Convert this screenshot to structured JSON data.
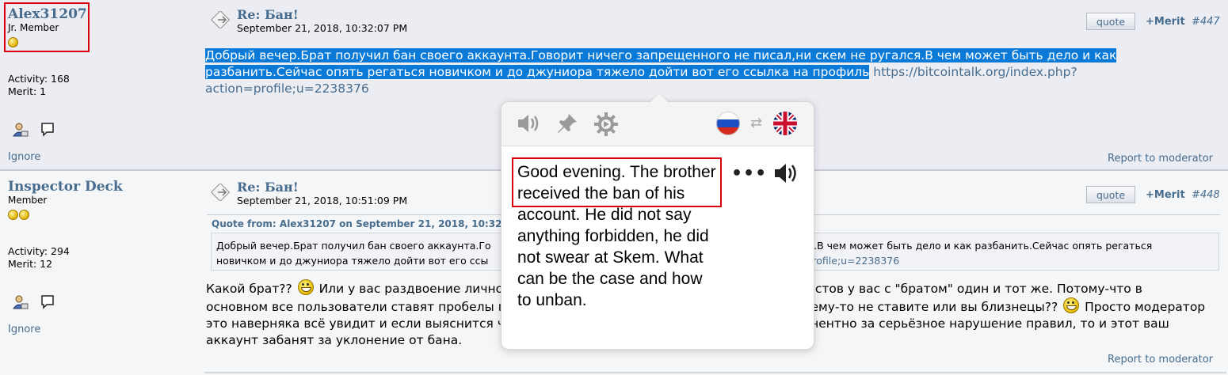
{
  "post1": {
    "username": "Alex31207",
    "rank": "Jr. Member",
    "activity": "Activity: 168",
    "merit": "Merit: 1",
    "ignore": "Ignore",
    "subject": "Re: Бан!",
    "date": "September 21, 2018, 10:32:07 PM",
    "quote_label": "quote",
    "merit_label": "+Merit",
    "number": "#447",
    "body_highlighted_1": "Добрый вечер.Брат получил бан своего аккаунта.Говорит ничего запрещенного не писал,ни скем не ругался.В чем может быть дело и как",
    "body_highlighted_2": "разбанить.Сейчас опять регаться новичком и до джуниора тяжело дойти вот его ссылка на профиль",
    "body_link": " https://bitcointalk.org/index.php?action=profile;u=2238376",
    "report": "Report to moderator"
  },
  "post2": {
    "username": "Inspector Deck",
    "rank": "Member",
    "activity": "Activity: 294",
    "merit": "Merit: 12",
    "ignore": "Ignore",
    "subject": "Re: Бан!",
    "date": "September 21, 2018, 10:51:09 PM",
    "quote_label": "quote",
    "merit_label": "+Merit",
    "number": "#448",
    "quote_header": "Quote from: Alex31207 on September 21, 2018, 10:32",
    "quote_text_1a": "Добрый вечер.Брат получил бан своего аккаунта.Го",
    "quote_text_1b": "я.В чем может быть дело и как разбанить.Сейчас опять регаться",
    "quote_text_2a": "новичком и до джуниора тяжело дойти вот его ссы",
    "quote_text_2b": "rofile;u=2238376",
    "body_1a": "Какой брат?? ",
    "body_1b": " Или у вас раздвоение лично",
    "body_1c": "иль постов у вас с \"братом\" один и тот же. Потому-что в",
    "body_2a": "основном все пользователи ставят пробелы п",
    "body_2b": "очему-то не ставите или вы близнецы?? ",
    "body_2c": " Просто модератор",
    "body_3a": "это наверняка всё увидит и если выяснится ч",
    "body_3b": "манентно за серьёзное нарушение правил, то и этот ваш",
    "body_4": "аккаунт забанят за уклонение от бана.",
    "report": "Report to moderator"
  },
  "translator": {
    "source_lang": "Russian",
    "target_lang": "English",
    "translation": "Good evening. The brother received the ban of his account. He did not say anything forbidden, he did not swear at Skem. What can be the case and how to unban.",
    "more": "•••",
    "icons": [
      "speaker-icon",
      "pin-icon",
      "gear-icon",
      "russian-flag-icon",
      "swap-icon",
      "uk-flag-icon"
    ]
  },
  "colors": {
    "link": "#476c8e",
    "highlight": "#0a7ad9",
    "annotation": "#d8000c"
  }
}
